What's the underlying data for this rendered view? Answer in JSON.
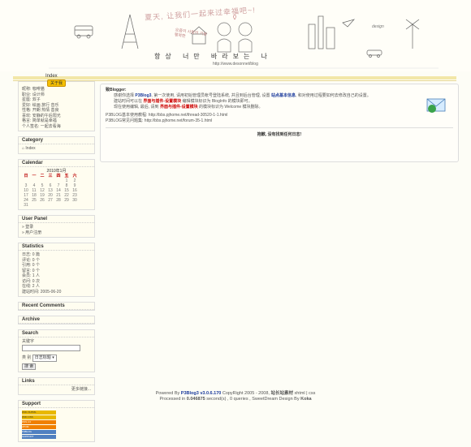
{
  "header": {
    "arc_text": "夏天, 让我们一起来过幸福吧~!",
    "small_sign": "요즘이 사랑이 기분 행복한",
    "title": "항상 너만 바라보는 나",
    "url": "http://www.desonnet/blog",
    "flag_text": "design"
  },
  "nav": {
    "index_label": "Index"
  },
  "sidebar": {
    "profile_badge": "关于我",
    "profile_lines": [
      "昵称: 咖啡猫",
      "职业: 设计师",
      "星座: 双子",
      "爱好: 绘画 旅行 音乐",
      "性格: 开朗 热情 善良",
      "喜欢: 安静的午后阳光",
      "格言: 简单就是幸福",
      "个人签名: 一起去看海"
    ],
    "category": {
      "title": "Category",
      "index_label": "Index"
    },
    "calendar": {
      "title": "Calendar",
      "month_label": "2010年1月",
      "weekdays": [
        "日",
        "一",
        "二",
        "三",
        "四",
        "五",
        "六"
      ],
      "rows": [
        [
          "",
          "",
          "",
          "",
          "",
          "1",
          "2"
        ],
        [
          "3",
          "4",
          "5",
          "6",
          "7",
          "8",
          "9"
        ],
        [
          "10",
          "11",
          "12",
          "13",
          "14",
          "15",
          "16"
        ],
        [
          "17",
          "18",
          "19",
          "20",
          "21",
          "22",
          "23"
        ],
        [
          "24",
          "25",
          "26",
          "27",
          "28",
          "29",
          "30"
        ],
        [
          "31",
          "",
          "",
          "",
          "",
          "",
          ""
        ]
      ]
    },
    "user_panel": {
      "title": "User Panel",
      "login": "登录",
      "register": "用户注册"
    },
    "statistics": {
      "title": "Statistics",
      "lines": [
        "日志: 0 篇",
        "评论: 0 个",
        "引用: 0 个",
        "留言: 0 个",
        "会员: 1 人",
        "访问: 0 次",
        "在线: 2 人",
        "建站时间: 2005-06-20"
      ]
    },
    "recent_comments": {
      "title": "Recent Comments"
    },
    "archive": {
      "title": "Archive"
    },
    "search": {
      "title": "Search",
      "keyword_label": "关键字",
      "type_label": "类 别",
      "select_value": "日志标题",
      "button": "搜 索"
    },
    "links": {
      "title": "Links",
      "more": "更多链接..."
    },
    "support": {
      "title": "Support",
      "badges": [
        "W3C XHTML",
        "W3C CSS",
        "RSS 2.0",
        "ATOM",
        "P3BLOG",
        "SUPPORT"
      ]
    }
  },
  "main": {
    "greeting": "致Blogger:",
    "p1_a": "感谢你选择",
    "p1_brand": "P3Blog3",
    "p1_b": ", 第一次使用, 请用初始管理员帐号登陆系统, 并且到后台管理, 设置",
    "p1_link": "站点基本信息",
    "p1_c": ", 和对使用过程要如何去修改自己的设置。",
    "p2_a": "建站时间可以在",
    "p2_link": "界面与插件-设置模块",
    "p2_b": "编辑模块标识为 BlogInfo 的模块即可。",
    "p3_a": "现在使用编辑, 最后, 请到",
    "p3_link": "界面与插件-设置模块",
    "p3_b": "的模块标识为 Welcome 模块删除。",
    "line4": "P3BLOG基本使用教程: http://bbs.pjhome.net/thread-30520-1-1.html",
    "line5": "P3BLOG常见问题集: http://bbs.pjhome.net/forum-35-1.html",
    "empty_notice": "抱歉, 没有找到任何日志!"
  },
  "footer": {
    "line1_a": "Powered By",
    "line1_brand": "P3Blog3 v3.0.6.170",
    "line1_b": "CopyRight 2005 - 2008,",
    "line1_owner": "站长站素材",
    "line1_c": "xhtml | css",
    "line2_a": "Processed in",
    "line2_time": "0.046875",
    "line2_b": "second(s) , 0 queries , SweetDream Design By",
    "line2_author": "Koka"
  },
  "colors": {
    "nav_bar": "#f2e7a8",
    "link": "#1a3a9c",
    "accent_red": "#c00000",
    "badge_yellow": "#f5c000"
  }
}
